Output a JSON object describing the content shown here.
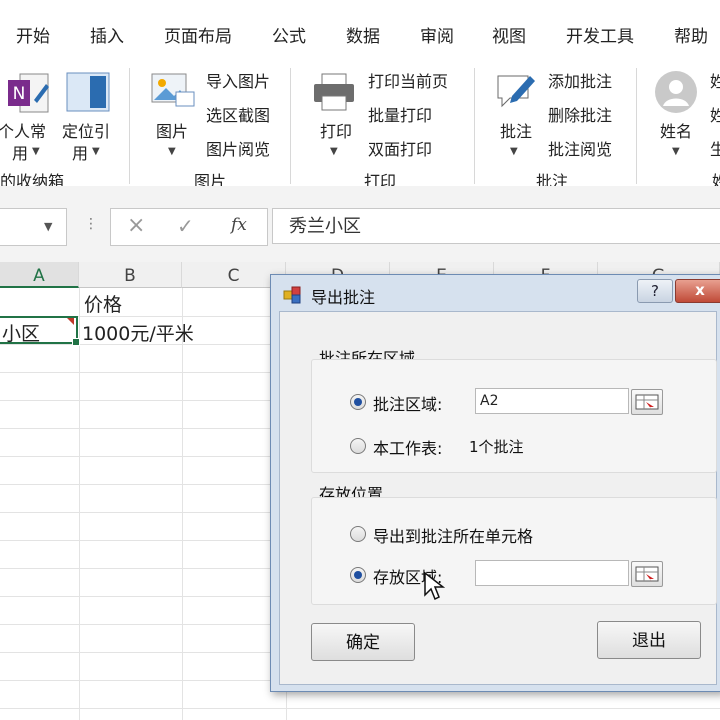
{
  "menu": {
    "tabs": [
      "开始",
      "插入",
      "页面布局",
      "公式",
      "数据",
      "审阅",
      "视图",
      "开发工具",
      "帮助"
    ]
  },
  "ribbon": {
    "group1": {
      "btn_personal_l1": "个人常",
      "btn_personal_l2": "用",
      "btn_locate_l1": "定位引",
      "btn_locate_l2": "用",
      "label": "的收纳箱"
    },
    "group_picture": {
      "big_button": "图片",
      "items": [
        "导入图片",
        "选区截图",
        "图片阅览"
      ],
      "label": "图片"
    },
    "group_print": {
      "big_button": "打印",
      "items": [
        "打印当前页",
        "批量打印",
        "双面打印"
      ],
      "label": "打印"
    },
    "group_comment": {
      "big_button": "批注",
      "items": [
        "添加批注",
        "删除批注",
        "批注阅览"
      ],
      "label": "批注"
    },
    "group_name": {
      "big_button": "姓名",
      "items": [
        "姓",
        "姓",
        "生"
      ],
      "label": "姓"
    }
  },
  "formula_bar": {
    "cancel_glyph": "×",
    "enter_glyph": "✓",
    "fx_label": "fx",
    "content": "秀兰小区"
  },
  "sheet": {
    "columns": [
      "A",
      "B",
      "C",
      "D",
      "E",
      "F",
      "G"
    ],
    "row1": {
      "b": "价格"
    },
    "row2": {
      "a": "小区",
      "b": "1000元/平米"
    }
  },
  "dialog": {
    "title": "导出批注",
    "help_glyph": "?",
    "close_glyph": "x",
    "group1_label": "批注所在区域",
    "radio_range_label": "批注区域:",
    "radio_range_value": "A2",
    "radio_sheet_label": "本工作表:",
    "radio_sheet_info": "1个批注",
    "group2_label": "存放位置",
    "radio_export_cell_label": "导出到批注所在单元格",
    "radio_store_label": "存放区域:",
    "radio_store_value": "",
    "ok_label": "确定",
    "exit_label": "退出"
  },
  "colors": {
    "accent": "#1f4fa0",
    "onenote_purple": "#7a2b8c",
    "selection_green": "#217346",
    "comment_red": "#c0392b"
  }
}
